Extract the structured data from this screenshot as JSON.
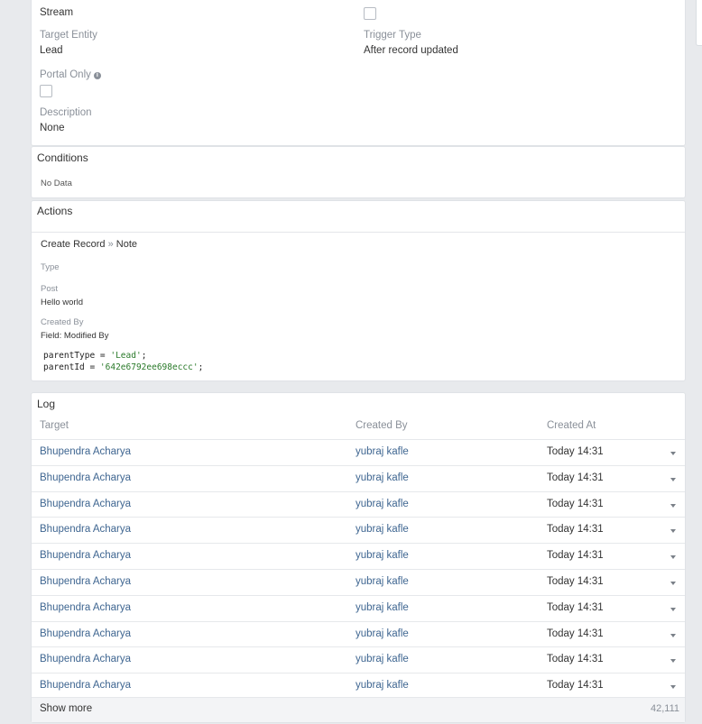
{
  "details": {
    "stream_label": "Stream",
    "target_entity_label": "Target Entity",
    "target_entity_value": "Lead",
    "trigger_type_label": "Trigger Type",
    "trigger_type_value": "After record updated",
    "portal_only_label": "Portal Only",
    "description_label": "Description",
    "description_value": "None"
  },
  "conditions": {
    "title": "Conditions",
    "empty_text": "No Data"
  },
  "actions": {
    "title": "Actions",
    "action_name": "Create Record",
    "action_separator": "»",
    "action_target": "Note",
    "type_label": "Type",
    "post_label": "Post",
    "post_value": "Hello world",
    "created_by_label": "Created By",
    "created_by_value": "Field: Modified By",
    "code_line1_key": "parentType = ",
    "code_line1_val": "'Lead'",
    "code_line1_end": ";",
    "code_line2_key": "parentId = ",
    "code_line2_val": "'642e6792ee698eccc'",
    "code_line2_end": ";"
  },
  "log": {
    "title": "Log",
    "columns": [
      "Target",
      "Created By",
      "Created At"
    ],
    "rows": [
      {
        "target": "Bhupendra Acharya",
        "created_by": "yubraj kafle",
        "created_at": "Today 14:31"
      },
      {
        "target": "Bhupendra Acharya",
        "created_by": "yubraj kafle",
        "created_at": "Today 14:31"
      },
      {
        "target": "Bhupendra Acharya",
        "created_by": "yubraj kafle",
        "created_at": "Today 14:31"
      },
      {
        "target": "Bhupendra Acharya",
        "created_by": "yubraj kafle",
        "created_at": "Today 14:31"
      },
      {
        "target": "Bhupendra Acharya",
        "created_by": "yubraj kafle",
        "created_at": "Today 14:31"
      },
      {
        "target": "Bhupendra Acharya",
        "created_by": "yubraj kafle",
        "created_at": "Today 14:31"
      },
      {
        "target": "Bhupendra Acharya",
        "created_by": "yubraj kafle",
        "created_at": "Today 14:31"
      },
      {
        "target": "Bhupendra Acharya",
        "created_by": "yubraj kafle",
        "created_at": "Today 14:31"
      },
      {
        "target": "Bhupendra Acharya",
        "created_by": "yubraj kafle",
        "created_at": "Today 14:31"
      },
      {
        "target": "Bhupendra Acharya",
        "created_by": "yubraj kafle",
        "created_at": "Today 14:31"
      }
    ],
    "show_more_label": "Show more",
    "total_count": "42,111"
  }
}
